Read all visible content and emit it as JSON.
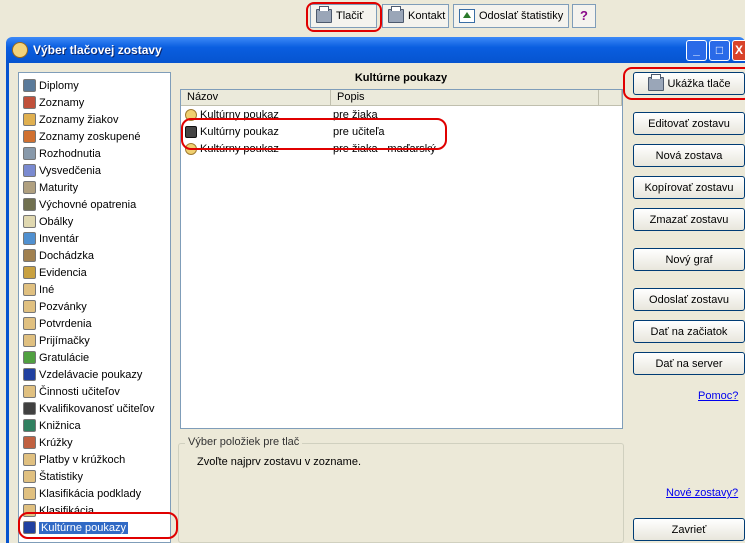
{
  "toolbar": {
    "print_label": "Tlačiť",
    "contact_label": "Kontakt",
    "send_stats_label": "Odoslať štatistiky",
    "help_icon": "?"
  },
  "window": {
    "title": "Výber tlačovej zostavy",
    "controls": {
      "minimize": "_",
      "maximize": "□",
      "close": "X"
    }
  },
  "sidebar": {
    "items": [
      {
        "label": "Diplomy",
        "icon": "diploma-icon",
        "color": "#5a7a9a"
      },
      {
        "label": "Zoznamy",
        "icon": "house-icon",
        "color": "#c0503a"
      },
      {
        "label": "Zoznamy žiakov",
        "icon": "students-icon",
        "color": "#e0b050"
      },
      {
        "label": "Zoznamy zoskupené",
        "icon": "group-icon",
        "color": "#d07030"
      },
      {
        "label": "Rozhodnutia",
        "icon": "document-icon",
        "color": "#8899aa"
      },
      {
        "label": "Vysvedčenia",
        "icon": "certificate-icon",
        "color": "#7a8ad0"
      },
      {
        "label": "Maturity",
        "icon": "cup-icon",
        "color": "#b0a080"
      },
      {
        "label": "Výchovné opatrenia",
        "icon": "hat-icon",
        "color": "#707050"
      },
      {
        "label": "Obálky",
        "icon": "envelope-icon",
        "color": "#e0d8b0"
      },
      {
        "label": "Inventár",
        "icon": "computer-icon",
        "color": "#5090d0"
      },
      {
        "label": "Dochádzka",
        "icon": "snail-icon",
        "color": "#a08050"
      },
      {
        "label": "Evidencia",
        "icon": "folder-icon",
        "color": "#c8a040"
      },
      {
        "label": "Iné",
        "icon": "person-icon",
        "color": "#e0c080"
      },
      {
        "label": "Pozvánky",
        "icon": "person-icon",
        "color": "#e0c080"
      },
      {
        "label": "Potvrdenia",
        "icon": "person-icon",
        "color": "#e0c080"
      },
      {
        "label": "Prijímačky",
        "icon": "person-plus-icon",
        "color": "#e0c080"
      },
      {
        "label": "Gratulácie",
        "icon": "gift-icon",
        "color": "#50a040"
      },
      {
        "label": "Vzdelávacie poukazy",
        "icon": "checkmark-icon",
        "color": "#2040a0"
      },
      {
        "label": "Činnosti učiteľov",
        "icon": "person-icon",
        "color": "#e0c080"
      },
      {
        "label": "Kvalifikovanosť učiteľov",
        "icon": "teacher-icon",
        "color": "#404040"
      },
      {
        "label": "Knižnica",
        "icon": "book-icon",
        "color": "#308060"
      },
      {
        "label": "Krúžky",
        "icon": "group-icon",
        "color": "#c06040"
      },
      {
        "label": "Platby v krúžkoch",
        "icon": "person-icon",
        "color": "#e0c080"
      },
      {
        "label": "Štatistiky",
        "icon": "person-icon",
        "color": "#e0c080"
      },
      {
        "label": "Klasifikácia podklady",
        "icon": "person-icon",
        "color": "#e0c080"
      },
      {
        "label": "Klasifikácia",
        "icon": "person-icon",
        "color": "#e0c080"
      },
      {
        "label": "Kultúrne poukazy",
        "icon": "checkmark-icon",
        "color": "#2040a0"
      }
    ]
  },
  "list": {
    "title": "Kultúrne poukazy",
    "columns": [
      "Názov",
      "Popis"
    ],
    "rows": [
      {
        "name": "Kultúrny poukaz",
        "desc": "pre žiaka"
      },
      {
        "name": "Kultúrny poukaz",
        "desc": "pre učiteľa"
      },
      {
        "name": "Kultúrny poukaz",
        "desc": "pre žiaka - maďarský"
      }
    ]
  },
  "selection": {
    "legend": "Výber položiek pre tlač",
    "message": "Zvoľte najprv zostavu v zozname."
  },
  "actions": {
    "preview": "Ukážka tlače",
    "edit": "Editovať zostavu",
    "new": "Nová zostava",
    "copy": "Kopírovať zostavu",
    "delete": "Zmazať zostavu",
    "new_graph": "Nový graf",
    "send": "Odoslať zostavu",
    "to_start": "Dať na začiatok",
    "to_server": "Dať na server",
    "help_link": "Pomoc?",
    "new_reports_link": "Nové zostavy?",
    "close": "Zavrieť"
  },
  "colors": {
    "title_bar": "#0654cf",
    "highlight_ring": "#e00000",
    "selection": "#316ac5"
  }
}
